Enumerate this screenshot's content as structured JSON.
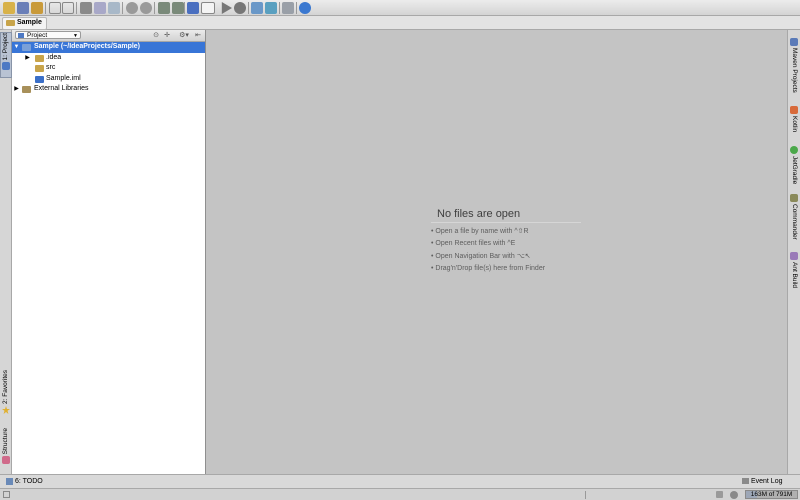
{
  "toolbar": {
    "icons": [
      "open-folder",
      "save",
      "sync",
      "undo",
      "redo",
      "cut",
      "copy",
      "paste",
      "find",
      "replace",
      "back",
      "forward",
      "build",
      "run-config",
      "run",
      "debug",
      "sdk",
      "vcs",
      "project-structure",
      "help"
    ]
  },
  "navbar": {
    "crumb": "Sample"
  },
  "left_strip": {
    "project_tab": "1: Project",
    "favorites_tab": "2: Favorites",
    "structure_tab": "Structure"
  },
  "project_panel": {
    "view_selector": "Project",
    "tree": [
      {
        "label": "Sample (~/IdeaProjects/Sample)",
        "icon": "module-folder-icon",
        "selected": true,
        "expanded": true
      },
      {
        "label": ".idea",
        "icon": "folder-icon"
      },
      {
        "label": "src",
        "icon": "folder-icon"
      },
      {
        "label": "Sample.iml",
        "icon": "iml-file-icon"
      },
      {
        "label": "External Libraries",
        "icon": "libraries-icon"
      }
    ]
  },
  "editor": {
    "empty_title": "No files are open",
    "hints": [
      "• Open a file by name with ^⇧R",
      "• Open Recent files with ^E",
      "• Open Navigation Bar with ⌥↖",
      "• Drag'n'Drop file(s) here from Finder"
    ]
  },
  "right_strip": {
    "tabs": [
      "Maven Projects",
      "Kotlin",
      "JetGradle",
      "Commander",
      "Ant Build"
    ]
  },
  "bottom_bar": {
    "todo": "6: TODO",
    "event_log": "Event Log"
  },
  "status_bar": {
    "memory": "163M of 791M",
    "memory_used_fraction": 0.206
  },
  "colors": {
    "selection": "#3875d7",
    "editor_bg": "#c4c4c4",
    "folder": "#c8a44a"
  }
}
